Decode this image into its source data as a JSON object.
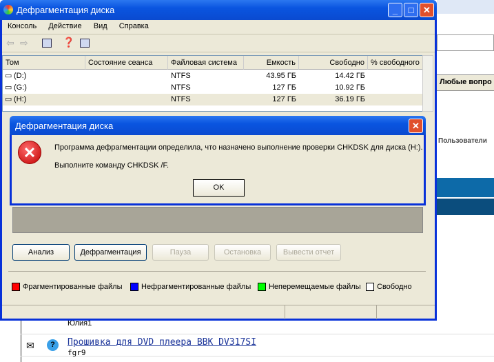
{
  "background": {
    "question_header": "Любые вопро",
    "users_header": "Пользователи",
    "rows": [
      {
        "author": "Юлия1"
      },
      {
        "title": "Прошивка для DVD плеера BBK DV317SI",
        "author": "fgr9"
      }
    ]
  },
  "window": {
    "title": "Дефрагментация диска",
    "menu": [
      "Консоль",
      "Действие",
      "Вид",
      "Справка"
    ],
    "columns": [
      "Том",
      "Состояние сеанса",
      "Файловая система",
      "Емкость",
      "Свободно",
      "% свободного"
    ],
    "volumes": [
      {
        "name": "(D:)",
        "state": "",
        "fs": "NTFS",
        "capacity": "43.95 ГБ",
        "free": "14.42 ГБ",
        "pct": ""
      },
      {
        "name": "(G:)",
        "state": "",
        "fs": "NTFS",
        "capacity": "127 ГБ",
        "free": "10.92 ГБ",
        "pct": ""
      },
      {
        "name": "(H:)",
        "state": "",
        "fs": "NTFS",
        "capacity": "127 ГБ",
        "free": "36.19 ГБ",
        "pct": ""
      }
    ],
    "buttons": {
      "analyze": "Анализ",
      "defrag": "Дефрагментация",
      "pause": "Пауза",
      "stop": "Остановка",
      "report": "Вывести отчет"
    },
    "legend": [
      {
        "label": "Фрагментированные файлы",
        "color": "#ff0000"
      },
      {
        "label": "Нефрагментированные файлы",
        "color": "#0000ff"
      },
      {
        "label": "Неперемещаемые файлы",
        "color": "#00ff00"
      },
      {
        "label": "Свободно",
        "color": "#ffffff"
      }
    ]
  },
  "dialog": {
    "title": "Дефрагментация диска",
    "message": "Программа дефрагментации определила, что назначено выполнение проверки CHKDSK для диска (H:).",
    "instruction": "Выполните команду CHKDSK /F.",
    "ok": "OK",
    "icon": "error-icon"
  }
}
